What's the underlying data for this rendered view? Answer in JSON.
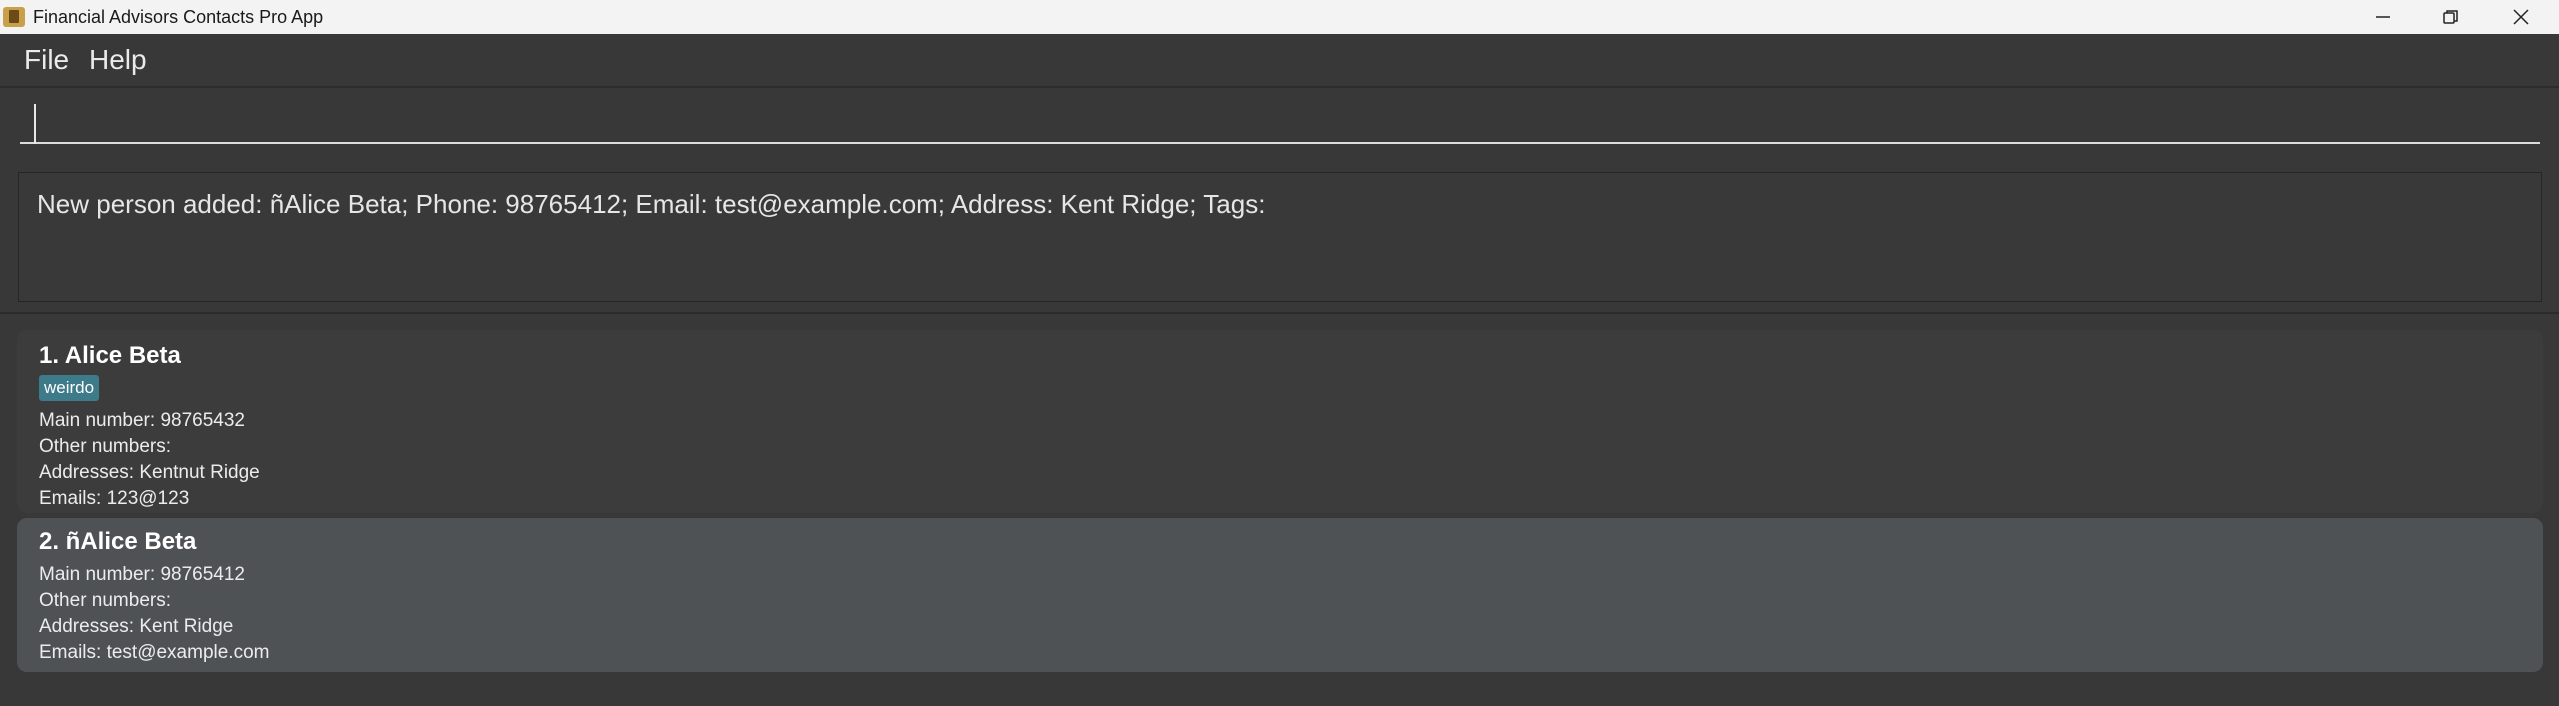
{
  "window": {
    "title": "Financial Advisors Contacts Pro App",
    "icons": {
      "app": "app-logo-icon",
      "minimize": "minimize-icon",
      "restore": "restore-icon",
      "close": "close-icon"
    }
  },
  "menu": {
    "file": "File",
    "help": "Help"
  },
  "command": {
    "value": "",
    "placeholder": ""
  },
  "result": {
    "message": "New person added: ñAlice Beta; Phone: 98765412; Email: test@example.com; Address: Kent Ridge; Tags:"
  },
  "persons": [
    {
      "name": "1. Alice Beta",
      "tag": "weirdo",
      "main_number": "Main number:  98765432",
      "other_numbers": "Other numbers:",
      "addresses": "Addresses:  Kentnut Ridge",
      "emails": "Emails:  123@123"
    },
    {
      "name": "2. ñAlice Beta",
      "main_number": "Main number:  98765412",
      "other_numbers": "Other numbers:",
      "addresses": "Addresses:  Kent Ridge",
      "emails": "Emails:  test@example.com"
    }
  ],
  "colors": {
    "background": "#383838",
    "selected_card": "#4f5255",
    "tag": "#3d7b8a"
  }
}
